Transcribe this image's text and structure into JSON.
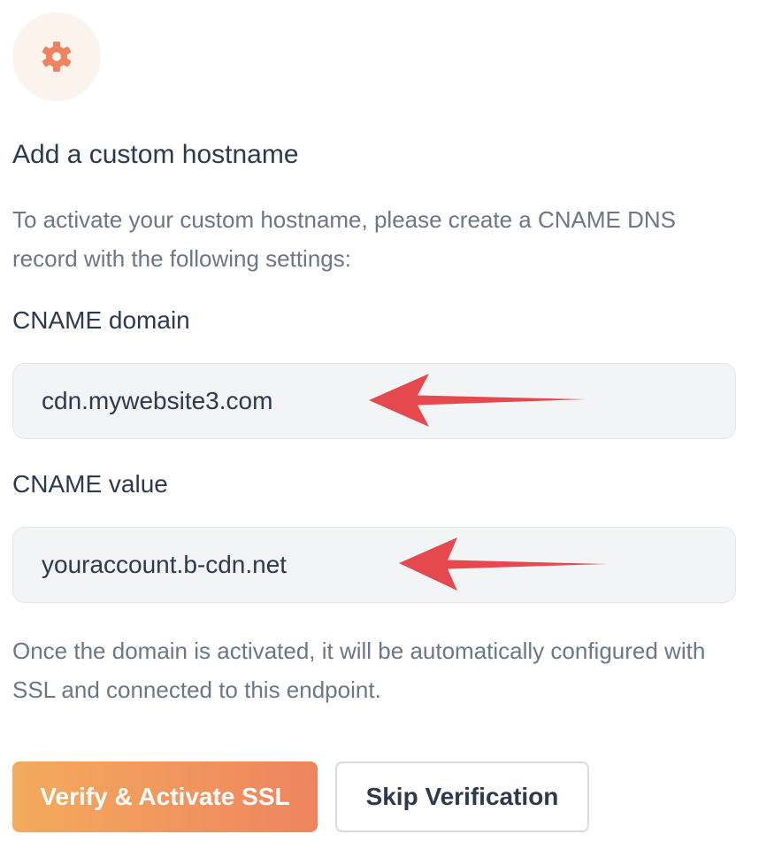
{
  "colors": {
    "accent": "#ee845f",
    "icon_bg": "#fcf3ec",
    "arrow": "#e5484d",
    "text_dark": "#2d3a4e",
    "text_muted": "#6b7686"
  },
  "header": {
    "icon": "gear-icon",
    "title": "Add a custom hostname",
    "description": "To activate your custom hostname, please create a CNAME DNS record with the following settings:"
  },
  "fields": {
    "domain": {
      "label": "CNAME domain",
      "value": "cdn.mywebsite3.com"
    },
    "value": {
      "label": "CNAME value",
      "value": "youraccount.b-cdn.net"
    }
  },
  "annotations": {
    "icon": "left-arrow-icon"
  },
  "note": "Once the domain is activated, it will be automatically configured with SSL and connected to this endpoint.",
  "actions": {
    "verify_label": "Verify & Activate SSL",
    "skip_label": "Skip Verification"
  }
}
